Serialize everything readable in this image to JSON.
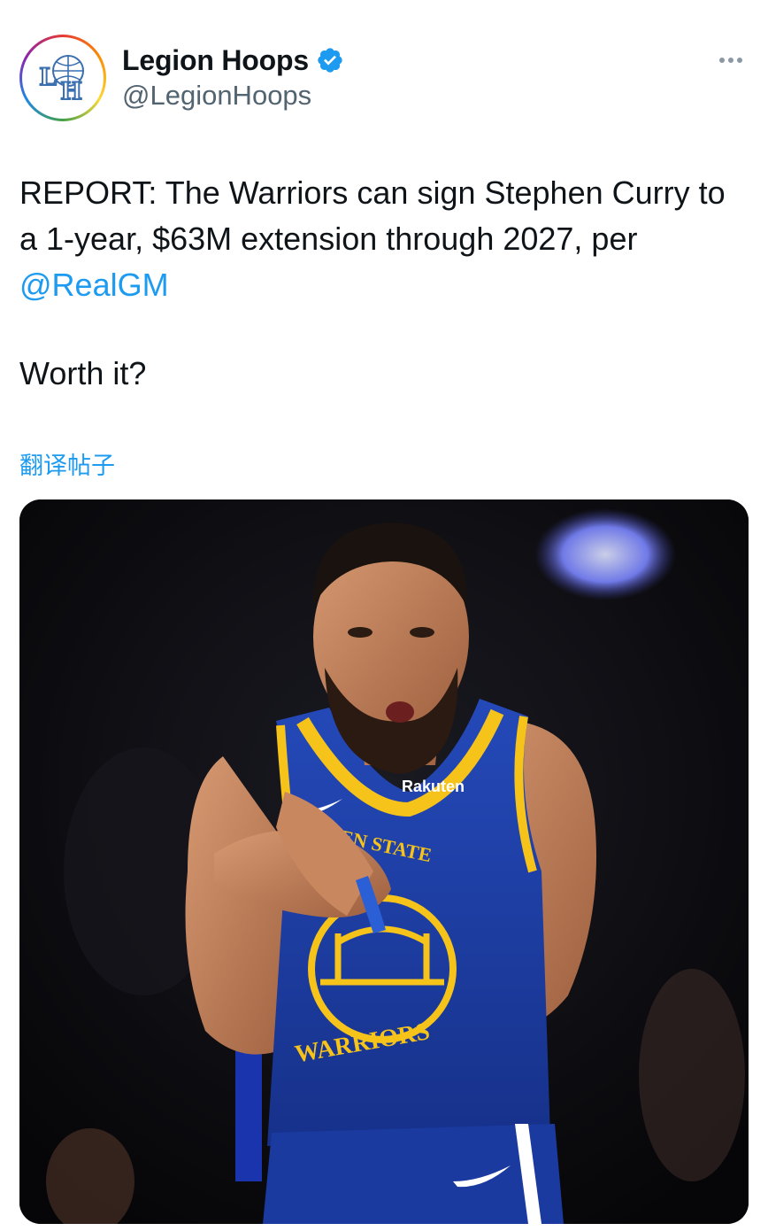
{
  "author": {
    "display_name": "Legion Hoops",
    "handle": "@LegionHoops",
    "avatar_letters": "LH",
    "verified_icon": "verified-badge-icon",
    "more_icon": "more-horizontal-icon"
  },
  "tweet": {
    "text_lines": [
      "REPORT: The Warriors can sign Stephen Curry to",
      "a 1-year, $63M extension through 2027, per"
    ],
    "mention": "@RealGM",
    "question": "Worth it?",
    "translate_label": "翻译帖子"
  },
  "media": {
    "jersey_sponsor": "Rakuten",
    "jersey_wordmark_top": "EN STATE",
    "jersey_wordmark_bottom": "WARRIORS"
  },
  "colors": {
    "text_primary": "#0f1419",
    "text_secondary": "#536471",
    "link": "#1d9bf0",
    "verified": "#1d9bf0",
    "jersey_blue": "#1d3fa3",
    "jersey_gold": "#f6c31b"
  }
}
